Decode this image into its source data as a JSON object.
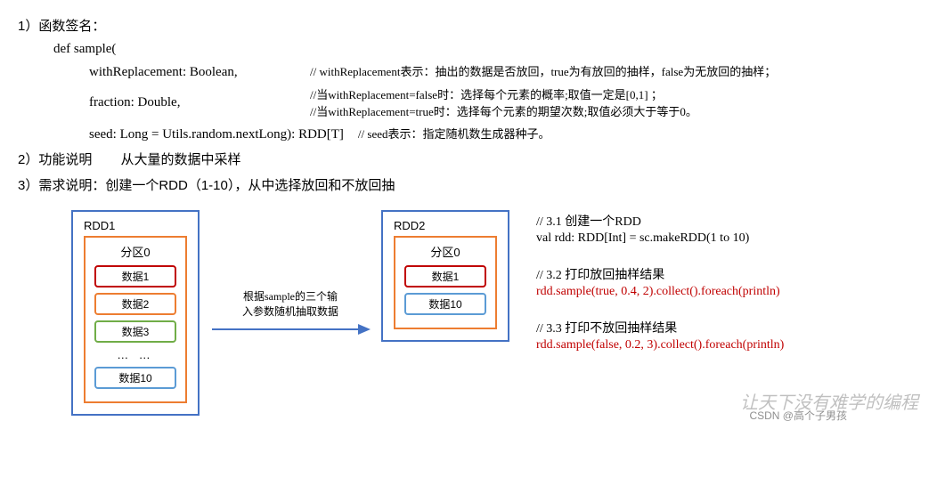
{
  "s1": {
    "header": "1）函数签名：",
    "def": "def sample(",
    "p1_code": "withReplacement: Boolean,",
    "p1_comment": "// withReplacement表示：抽出的数据是否放回，true为有放回的抽样，false为无放回的抽样；",
    "p2_code": "fraction: Double,",
    "p2_comment_a": "//当withReplacement=false时：选择每个元素的概率;取值一定是[0,1] ；",
    "p2_comment_b": "//当withReplacement=true时：选择每个元素的期望次数;取值必须大于等于0。",
    "p3_code": "seed: Long = Utils.random.nextLong): RDD[T]",
    "p3_comment": "// seed表示：指定随机数生成器种子。"
  },
  "s2": {
    "header": "2）功能说明",
    "desc": "从大量的数据中采样"
  },
  "s3": {
    "header": "3）需求说明：创建一个RDD（1-10），从中选择放回和不放回抽"
  },
  "diagram": {
    "rdd1": {
      "title": "RDD1",
      "partition": "分区0",
      "items": [
        "数据1",
        "数据2",
        "数据3",
        "… …",
        "数据10"
      ]
    },
    "arrow_label_a": "根据sample的三个输",
    "arrow_label_b": "入参数随机抽取数据",
    "rdd2": {
      "title": "RDD2",
      "partition": "分区0",
      "items": [
        "数据1",
        "数据10"
      ]
    }
  },
  "code": {
    "b1_comment": "// 3.1 创建一个RDD",
    "b1_code": "val rdd: RDD[Int] = sc.makeRDD(1 to 10)",
    "b2_comment": "// 3.2 打印放回抽样结果",
    "b2_code": "rdd.sample(true, 0.4, 2).collect().foreach(println)",
    "b3_comment": "// 3.3 打印不放回抽样结果",
    "b3_code": "rdd.sample(false, 0.2, 3).collect().foreach(println)"
  },
  "watermark": "让天下没有难学的编程",
  "csdn": "CSDN @高个子男孩"
}
